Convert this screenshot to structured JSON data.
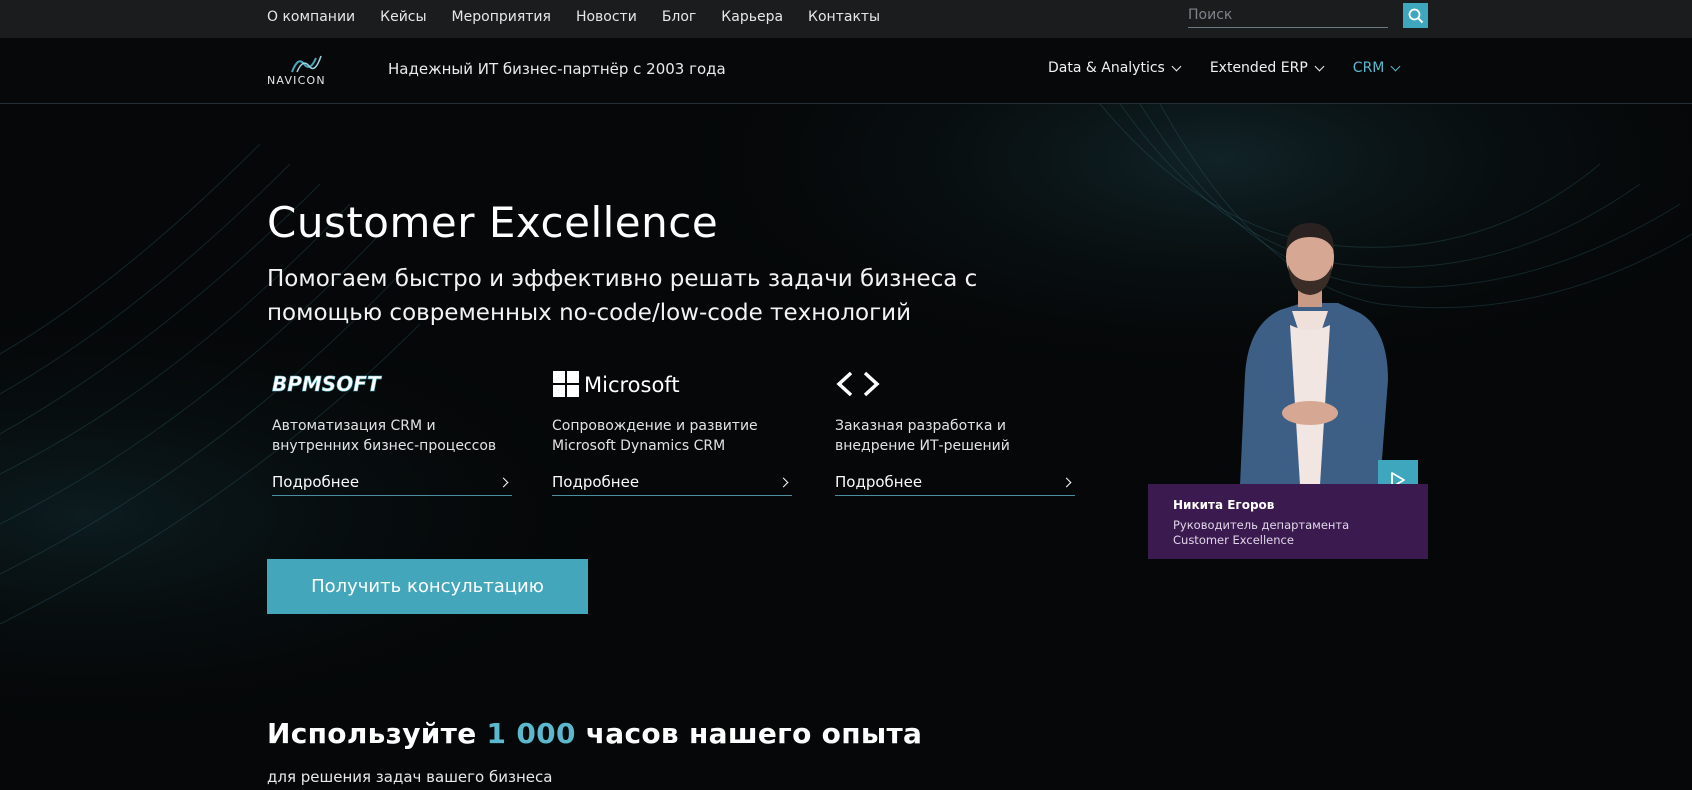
{
  "topnav": {
    "items": [
      "О компании",
      "Кейсы",
      "Мероприятия",
      "Новости",
      "Блог",
      "Карьера",
      "Контакты"
    ],
    "search_placeholder": "Поиск"
  },
  "header": {
    "logo_text": "NAVICON",
    "tagline": "Надежный ИТ бизнес-партнёр с 2003 года",
    "nav": [
      {
        "label": "Data & Analytics",
        "active": false
      },
      {
        "label": "Extended ERP",
        "active": false
      },
      {
        "label": "CRM",
        "active": true
      }
    ]
  },
  "hero": {
    "title": "Customer Excellence",
    "subtitle": "Помогаем быстро и эффективно решать задачи бизнеса с помощью современных no-code/low-code технологий",
    "cards": [
      {
        "brand": "BPMSOFT",
        "description": "Автоматизация CRM и внутренних бизнес-процессов",
        "link": "Подробнее"
      },
      {
        "brand": "Microsoft",
        "description": "Сопровождение и развитие Microsoft Dynamics CRM",
        "link": "Подробнее"
      },
      {
        "brand": "code-brackets-icon",
        "description": "Заказная разработка и внедрение ИТ-решений",
        "link": "Подробнее"
      }
    ],
    "cta_label": "Получить консультацию",
    "person": {
      "name": "Никита Егоров",
      "role": "Руководитель департамента Customer Excellence"
    }
  },
  "experience": {
    "title_before": "Используйте ",
    "title_accent": "1 000",
    "title_after": " часов нашего опыта",
    "subtitle": "для решения задач вашего бизнеса"
  },
  "colors": {
    "accent": "#3ea7bd",
    "accent_text": "#5cb8cc",
    "person_card": "#3b1a4f",
    "topbar": "#1b1c1e"
  }
}
